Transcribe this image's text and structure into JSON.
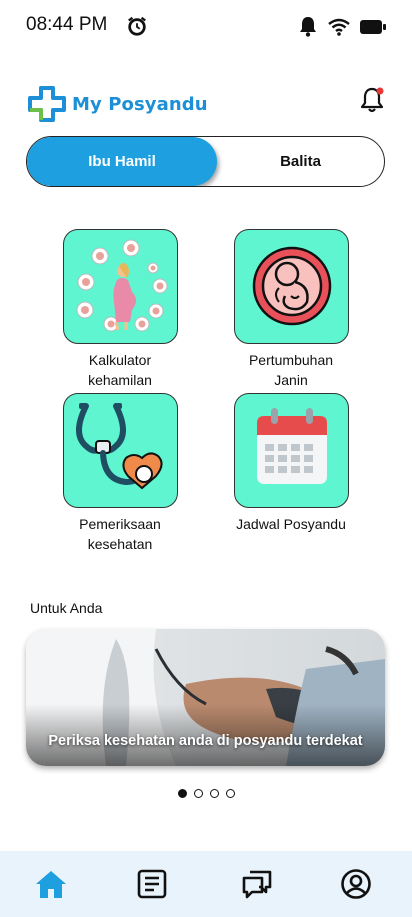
{
  "status_bar": {
    "time": "08:44 PM"
  },
  "app": {
    "name": "My Posyandu",
    "brand_color": "#1c8fd6",
    "accent_teal": "#5ef5d0"
  },
  "tabs": [
    {
      "label": "Ibu Hamil",
      "active": true
    },
    {
      "label": "Balita",
      "active": false
    }
  ],
  "menu": [
    {
      "label": "Kalkulator kehamilan",
      "icon": "pregnancy-calculator-icon"
    },
    {
      "label": "Pertumbuhan Janin",
      "icon": "fetus-icon"
    },
    {
      "label": "Pemeriksaan kesehatan",
      "icon": "stethoscope-icon"
    },
    {
      "label": "Jadwal Posyandu",
      "icon": "calendar-icon"
    }
  ],
  "section": {
    "title": "Untuk Anda"
  },
  "banner": {
    "caption": "Periksa kesehatan anda di posyandu terdekat"
  },
  "carousel": {
    "total": 4,
    "active_index": 0
  },
  "bottom_nav": [
    {
      "icon": "home-icon",
      "active": true
    },
    {
      "icon": "article-icon",
      "active": false
    },
    {
      "icon": "chat-icon",
      "active": false
    },
    {
      "icon": "profile-icon",
      "active": false
    }
  ]
}
